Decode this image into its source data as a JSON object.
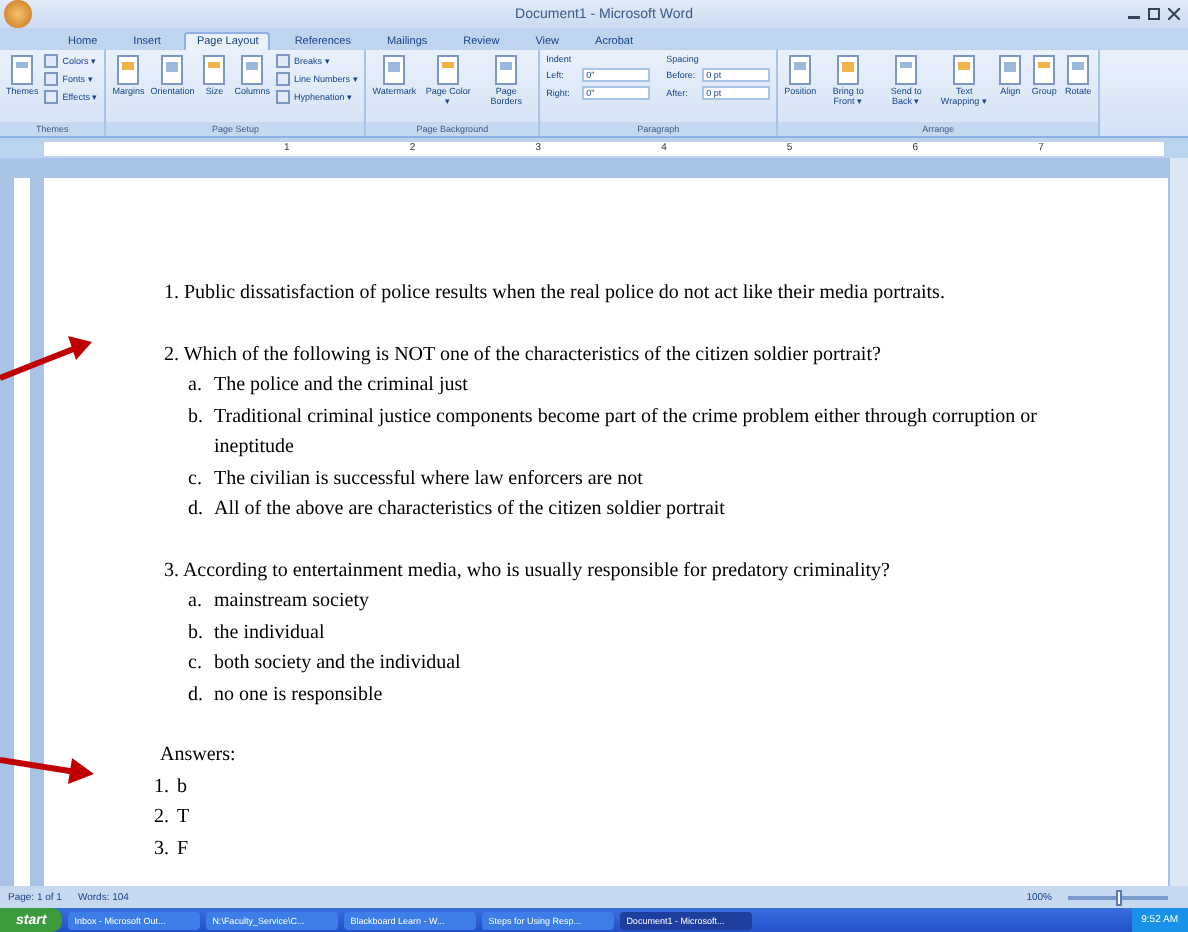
{
  "window": {
    "title": "Document1 - Microsoft Word"
  },
  "tabs": [
    {
      "label": "Home",
      "selected": false
    },
    {
      "label": "Insert",
      "selected": false
    },
    {
      "label": "Page Layout",
      "selected": true
    },
    {
      "label": "References",
      "selected": false
    },
    {
      "label": "Mailings",
      "selected": false
    },
    {
      "label": "Review",
      "selected": false
    },
    {
      "label": "View",
      "selected": false
    },
    {
      "label": "Acrobat",
      "selected": false
    }
  ],
  "ribbon_groups": [
    {
      "name": "Themes",
      "kind": "buttons",
      "large": [
        "Themes"
      ],
      "small": [
        "Colors ▾",
        "Fonts ▾",
        "Effects ▾"
      ]
    },
    {
      "name": "Page Setup",
      "kind": "buttons",
      "large": [
        "Margins",
        "Orientation",
        "Size",
        "Columns"
      ],
      "small": [
        "Breaks ▾",
        "Line Numbers ▾",
        "Hyphenation ▾"
      ]
    },
    {
      "name": "Page Background",
      "kind": "buttons",
      "large": [
        "Watermark",
        "Page Color ▾",
        "Page Borders"
      ]
    },
    {
      "name": "Paragraph",
      "kind": "fields",
      "sections": [
        {
          "heading": "Indent",
          "fields": [
            {
              "label": "Left:",
              "value": "0\""
            },
            {
              "label": "Right:",
              "value": "0\""
            }
          ]
        },
        {
          "heading": "Spacing",
          "fields": [
            {
              "label": "Before:",
              "value": "0 pt"
            },
            {
              "label": "After:",
              "value": "0 pt"
            }
          ]
        }
      ]
    },
    {
      "name": "Arrange",
      "kind": "buttons",
      "large": [
        "Position",
        "Bring to Front ▾",
        "Send to Back ▾",
        "Text Wrapping ▾",
        "Align",
        "Group",
        "Rotate"
      ]
    }
  ],
  "ruler_marks": [
    "1",
    "2",
    "3",
    "4",
    "5",
    "6",
    "7"
  ],
  "document": {
    "questions": [
      {
        "text": "1. Public dissatisfaction of police results when the real police do not act like their media portraits."
      },
      {
        "text": "2. Which of the following is NOT one of the characteristics of the citizen soldier portrait?",
        "options": [
          {
            "letter": "a.",
            "text": "The police and the criminal just"
          },
          {
            "letter": "b.",
            "text": "Traditional criminal justice components become part of the crime problem either through corruption or ineptitude"
          },
          {
            "letter": "c.",
            "text": "The civilian is successful where law enforcers are not"
          },
          {
            "letter": "d.",
            "text": "All of the above are characteristics of the citizen soldier portrait"
          }
        ]
      },
      {
        "text": "3. According to entertainment media, who is usually responsible for predatory criminality?",
        "options": [
          {
            "letter": "a.",
            "text": "mainstream society"
          },
          {
            "letter": "b.",
            "text": "the individual"
          },
          {
            "letter": "c.",
            "text": "both society and the individual"
          },
          {
            "letter": "d.",
            "text": "no one is responsible"
          }
        ]
      }
    ],
    "answers_heading": "Answers:",
    "answers": [
      {
        "number": "1.",
        "text": "b"
      },
      {
        "number": "2.",
        "text": "T"
      },
      {
        "number": "3.",
        "text": "F"
      }
    ]
  },
  "status_bar": {
    "page": "Page: 1 of 1",
    "words": "Words: 104",
    "zoom": "100%",
    "zoom_slider": {
      "level": 0.5
    }
  },
  "taskbar": {
    "start": "start",
    "items": [
      {
        "label": "Inbox - Microsoft Out...",
        "selected": false
      },
      {
        "label": "N:\\Faculty_Service\\C...",
        "selected": false
      },
      {
        "label": "Blackboard Learn - W...",
        "selected": false
      },
      {
        "label": "Steps for Using Resp...",
        "selected": false
      },
      {
        "label": "Document1 - Microsoft...",
        "selected": true
      }
    ],
    "time": "9:52 AM"
  }
}
